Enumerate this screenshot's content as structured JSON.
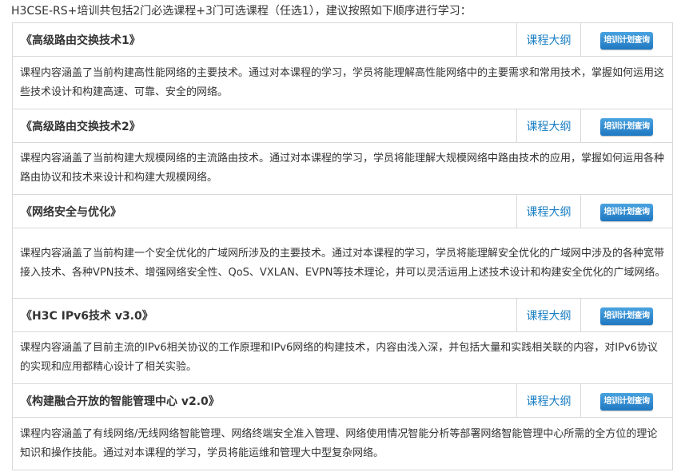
{
  "intro": "H3CSE-RS+培训共包括2门必选课程+3门可选课程（任选1），建议按照如下顺序进行学习：",
  "link_label": "课程大纲",
  "button_label": "培训计划查询",
  "colors": {
    "accent": "#1a7fc4",
    "border": "#d9d9d9",
    "text": "#333333"
  },
  "courses": [
    {
      "title": "《高级路由交换技术1》",
      "description": "课程内容涵盖了当前构建高性能网络的主要技术。通过对本课程的学习，学员将能理解高性能网络中的主要需求和常用技术，掌握如何运用这些技术设计和构建高速、可靠、安全的网络。"
    },
    {
      "title": "《高级路由交换技术2》",
      "description": "课程内容涵盖了当前构建大规模网络的主流路由技术。通过对本课程的学习，学员将能理解大规模网络中路由技术的应用，掌握如何运用各种路由协议和技术来设计和构建大规模网络。"
    },
    {
      "title": "《网络安全与优化》",
      "description": "课程内容涵盖了当前构建一个安全优化的广域网所涉及的主要技术。通过对本课程的学习，学员将能理解安全优化的广域网中涉及的各种宽带接入技术、各种VPN技术、增强网络安全性、QoS、VXLAN、EVPN等技术理论，并可以灵活运用上述技术设计和构建安全优化的广域网络。"
    },
    {
      "title": "《H3C IPv6技术 v3.0》",
      "description": "课程内容涵盖了目前主流的IPv6相关协议的工作原理和IPv6网络的构建技术，内容由浅入深，并包括大量和实践相关联的内容，对IPv6协议的实现和应用都精心设计了相关实验。"
    },
    {
      "title": "《构建融合开放的智能管理中心 v2.0》",
      "description": "课程内容涵盖了有线网络/无线网络智能管理、网络终端安全准入管理、网络使用情况智能分析等部署网络智能管理中心所需的全方位的理论知识和操作技能。通过对本课程的学习，学员将能运维和管理大中型复杂网络。"
    }
  ]
}
